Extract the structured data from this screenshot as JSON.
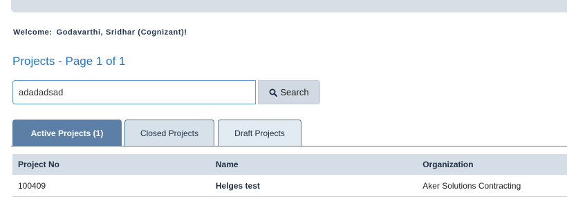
{
  "welcome": {
    "label": "Welcome:",
    "user": "Godavarthi, Sridhar (Cognizant)!"
  },
  "page_title": "Projects - Page 1 of 1",
  "search": {
    "value": "adadadsad",
    "button_label": "Search",
    "icon": "search-icon"
  },
  "tabs": [
    {
      "label": "Active Projects (1)",
      "active": true
    },
    {
      "label": "Closed Projects",
      "active": false
    },
    {
      "label": "Draft Projects",
      "active": false
    }
  ],
  "table": {
    "columns": [
      "Project No",
      "Name",
      "Organization"
    ],
    "rows": [
      [
        "100409",
        "Helges test",
        "Aker Solutions Contracting"
      ]
    ]
  },
  "colors": {
    "title_blue": "#2379c4",
    "active_tab": "#5b7fa6",
    "header_bg": "#d5dde6"
  }
}
